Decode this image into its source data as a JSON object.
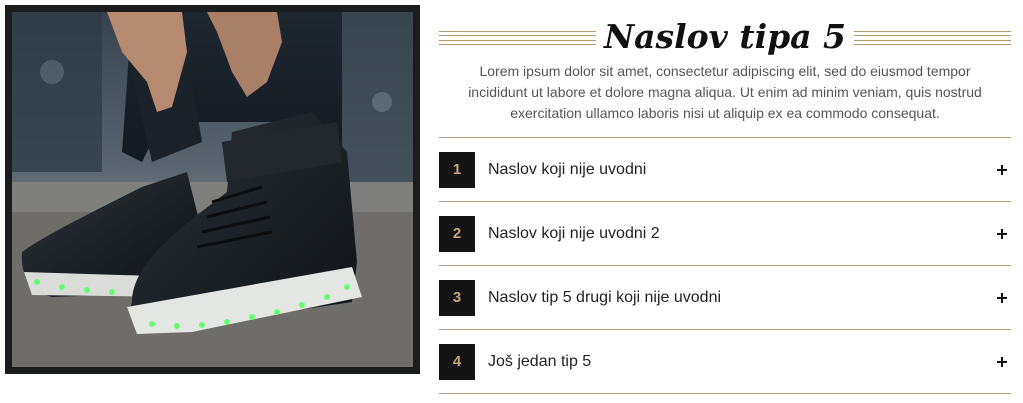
{
  "image": {
    "alt": "Sneakers with LED soles"
  },
  "heading": {
    "title": "Naslov tipa 5",
    "intro": "Lorem ipsum dolor sit amet, consectetur adipiscing elit, sed do eiusmod tempor incididunt ut labore et dolore magna aliqua. Ut enim ad minim veniam, quis nostrud exercitation ullamco laboris nisi ut aliquip ex ea commodo consequat."
  },
  "accordion": {
    "items": [
      {
        "number": "1",
        "label": "Naslov koji nije uvodni",
        "icon": "plus-icon"
      },
      {
        "number": "2",
        "label": "Naslov koji nije uvodni 2",
        "icon": "plus-icon"
      },
      {
        "number": "3",
        "label": "Naslov tip 5 drugi koji nije uvodni",
        "icon": "plus-icon"
      },
      {
        "number": "4",
        "label": "Još jedan tip 5",
        "icon": "plus-icon"
      }
    ]
  },
  "colors": {
    "accent_gold": "#b49b6e",
    "number_bg": "#141414",
    "number_text": "#c2a77a"
  }
}
